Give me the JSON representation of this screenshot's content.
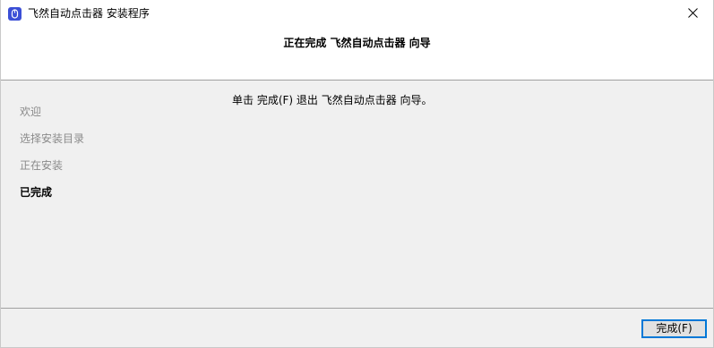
{
  "window": {
    "title": "飞然自动点击器 安装程序",
    "icon": "app-mouse-icon",
    "close_icon": "close-icon"
  },
  "header": {
    "title": "正在完成 飞然自动点击器 向导"
  },
  "steps": [
    {
      "label": "欢迎",
      "state": "done"
    },
    {
      "label": "选择安装目录",
      "state": "done"
    },
    {
      "label": "正在安装",
      "state": "done"
    },
    {
      "label": "已完成",
      "state": "active"
    }
  ],
  "main": {
    "message": "单击 完成(F) 退出 飞然自动点击器 向导。"
  },
  "footer": {
    "finish_label": "完成(F)"
  },
  "colors": {
    "accent": "#0078d7",
    "app_icon": "#3b4fd6",
    "inactive_step": "#8a8a8a"
  }
}
